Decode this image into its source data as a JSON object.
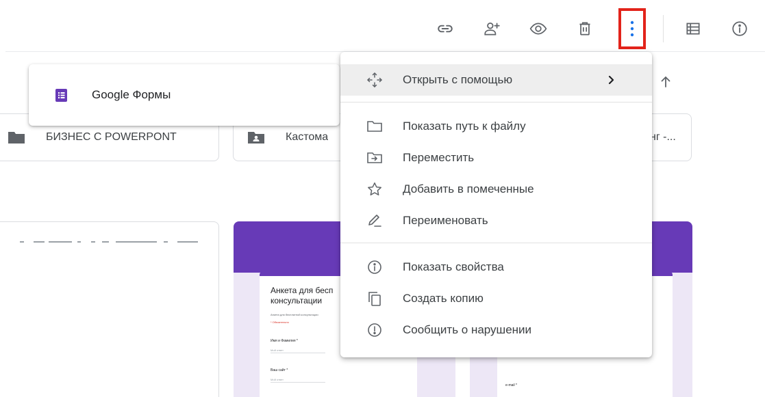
{
  "toolbar": {
    "buttons": [
      {
        "icon": "link-icon"
      },
      {
        "icon": "share-person-add-icon"
      },
      {
        "icon": "preview-eye-icon"
      },
      {
        "icon": "trash-icon"
      },
      {
        "icon": "more-vertical-icon"
      },
      {
        "icon": "list-view-icon"
      },
      {
        "icon": "info-icon"
      }
    ],
    "highlight_color": "#e2231a",
    "accent_color": "#1a73e8"
  },
  "folders": [
    {
      "label": "БИЗНЕС С POWERPONT",
      "icon": "folder-icon"
    },
    {
      "label": "Кастома",
      "icon": "shared-folder-icon"
    },
    {
      "label": "нг -...",
      "icon": ""
    }
  ],
  "files": [
    {
      "type": "form",
      "title": "Анкета для бесп консультации",
      "subtitle": "Анкета для бесплатной консультации",
      "required_note": "* Обязательно",
      "question": "Имя и Фамилия *",
      "answer_placeholder": "Мой ответ",
      "question2": "Ваш сайт *",
      "answer2_placeholder": "Мой ответ"
    },
    {
      "type": "form",
      "email_label": "e-mail *"
    }
  ],
  "submenu": {
    "items": [
      {
        "label": "Google Формы",
        "icon": "google-forms-icon",
        "color": "#673ab7"
      }
    ]
  },
  "context_menu": {
    "groups": [
      [
        {
          "label": "Открыть с помощью",
          "icon": "open-with-icon",
          "has_submenu": true,
          "active": true
        }
      ],
      [
        {
          "label": "Показать путь к файлу",
          "icon": "folder-outline-icon"
        },
        {
          "label": "Переместить",
          "icon": "move-to-folder-icon"
        },
        {
          "label": "Добавить в помеченные",
          "icon": "star-outline-icon"
        },
        {
          "label": "Переименовать",
          "icon": "pencil-icon"
        }
      ],
      [
        {
          "label": "Показать свойства",
          "icon": "info-icon"
        },
        {
          "label": "Создать копию",
          "icon": "copy-icon"
        },
        {
          "label": "Сообщить о нарушении",
          "icon": "report-icon"
        }
      ]
    ]
  }
}
